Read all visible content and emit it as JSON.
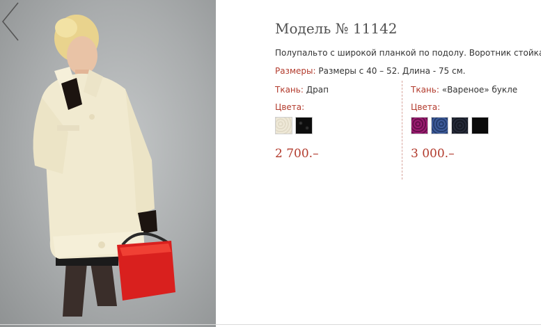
{
  "product": {
    "title": "Модель № 11142",
    "description": "Полупальто с широкой планкой по подолу. Воротник стойка.",
    "sizes_label": "Размеры:",
    "sizes_value": " Размеры с 40 – 52. Длина - 75 см."
  },
  "gallery": {
    "prev_icon": "chevron-left-icon"
  },
  "variants": [
    {
      "fabric_label": "Ткань:",
      "fabric_value": " Драп",
      "colors_label": "Цвета:",
      "swatches": [
        "cream",
        "black-speckled"
      ],
      "price": "2 700.–"
    },
    {
      "fabric_label": "Ткань:",
      "fabric_value": " «Вареное» букле",
      "colors_label": "Цвета:",
      "swatches": [
        "magenta",
        "blue",
        "navy",
        "black"
      ],
      "price": "3 000.–"
    }
  ],
  "colors": {
    "accent": "#b23a2c",
    "title_text": "#505050",
    "body_text": "#333333",
    "divider": "#d7a39b"
  }
}
